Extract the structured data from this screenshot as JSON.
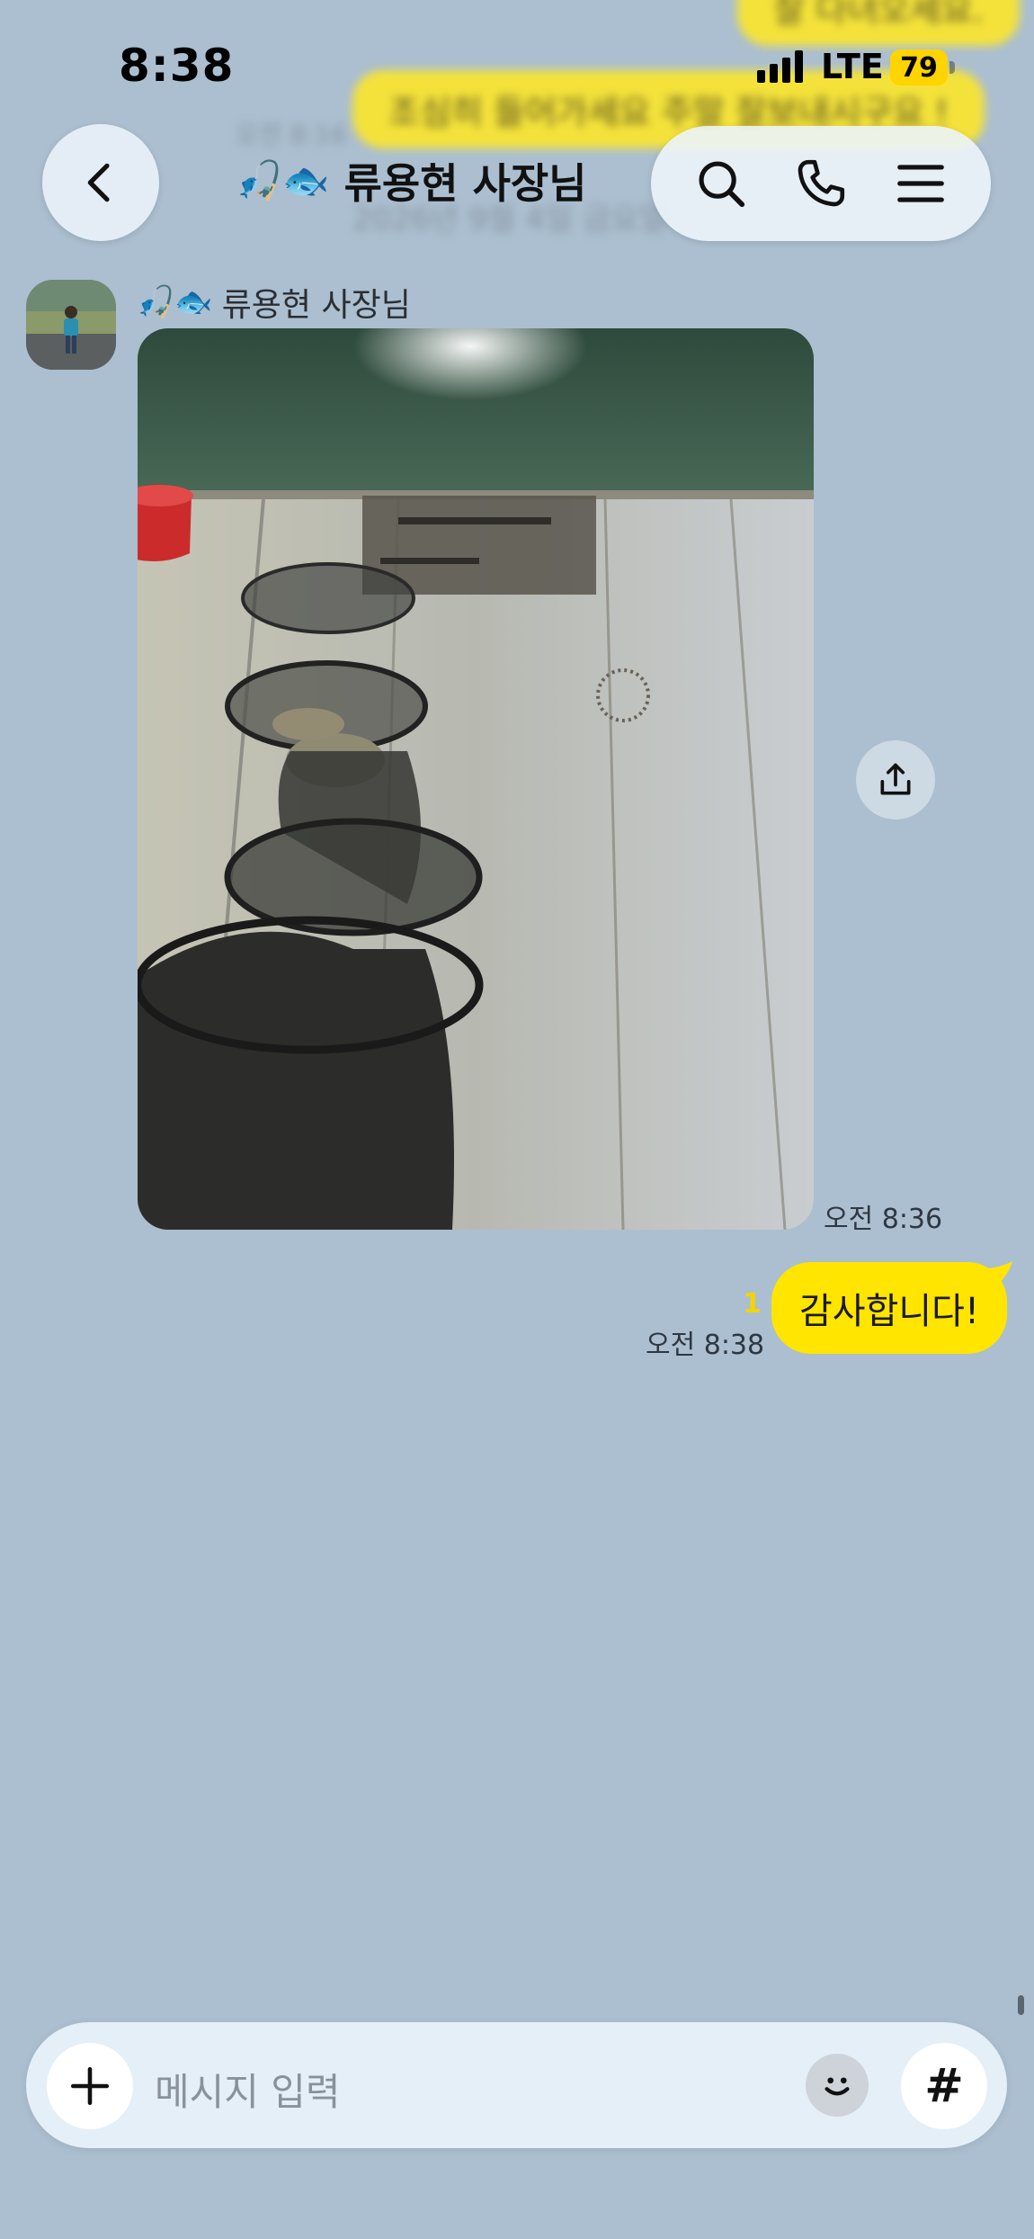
{
  "status_bar": {
    "time": "8:38",
    "network": "LTE",
    "battery": "79"
  },
  "header": {
    "title": "류용현 사장님",
    "title_emoji": "🎣",
    "title_emoji2": "🐟",
    "back_icon": "chevron-left-icon",
    "actions": [
      "search-icon",
      "phone-icon",
      "menu-icon"
    ]
  },
  "background_messages": {
    "bubble_top": "잘 다녀오세요.",
    "bubble": "조심히 들어가세요 주말 잘보내시구요 !",
    "time": "오전 8:16",
    "date": "2026년 9월 4일 금요일"
  },
  "messages": [
    {
      "from": "other",
      "sender": "류용현 사장님",
      "sender_emoji": "🎣",
      "sender_emoji2": "🐟",
      "type": "image",
      "image_desc": "fishing keep net with fish on a wooden dock",
      "time": "오전 8:36"
    },
    {
      "from": "me",
      "text": "감사합니다!",
      "unread": "1",
      "time": "오전 8:38"
    }
  ],
  "input": {
    "placeholder": "메시지 입력",
    "plus_icon": "plus-icon",
    "emoji_icon": "smiley-icon",
    "hash_label": "#"
  },
  "colors": {
    "background": "#abbfd0",
    "my_bubble": "#ffe500",
    "battery": "#ffd400"
  }
}
